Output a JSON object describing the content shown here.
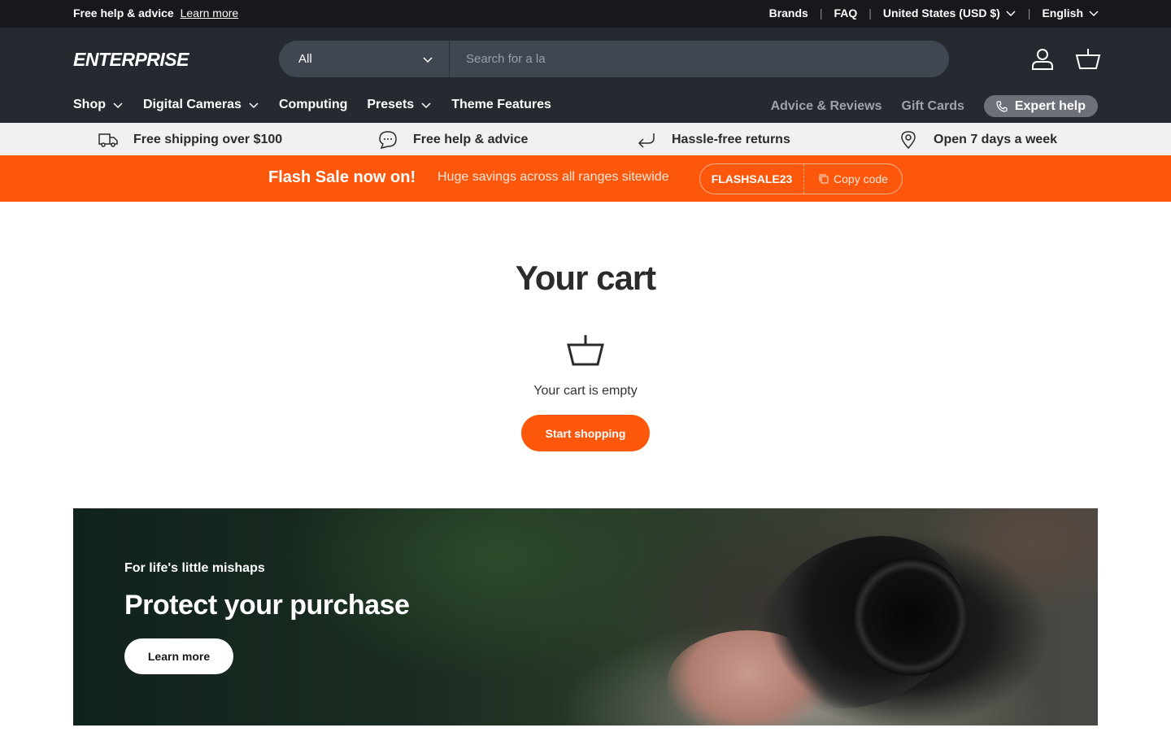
{
  "announcement": {
    "text": "Free help & advice",
    "link": "Learn more",
    "right_links": [
      "Brands",
      "FAQ"
    ],
    "currency": "United States (USD $)",
    "language": "English"
  },
  "header": {
    "logo": "ENTERPRISE",
    "search": {
      "category": "All",
      "placeholder": "Search for a la"
    }
  },
  "nav": {
    "left": [
      {
        "label": "Shop",
        "dropdown": true
      },
      {
        "label": "Digital Cameras",
        "dropdown": true
      },
      {
        "label": "Computing",
        "dropdown": false
      },
      {
        "label": "Presets",
        "dropdown": true
      },
      {
        "label": "Theme Features",
        "dropdown": false
      }
    ],
    "right": [
      "Advice & Reviews",
      "Gift Cards"
    ],
    "expert_help": "Expert help"
  },
  "usp": [
    {
      "icon": "truck-icon",
      "label": "Free shipping over $100"
    },
    {
      "icon": "chat-icon",
      "label": "Free help & advice"
    },
    {
      "icon": "return-arrow-icon",
      "label": "Hassle-free returns"
    },
    {
      "icon": "location-pin-icon",
      "label": "Open 7 days a week"
    }
  ],
  "flash_sale": {
    "title": "Flash Sale now on!",
    "subtitle": "Huge savings across all ranges sitewide",
    "code": "FLASHSALE23",
    "copy_label": "Copy code"
  },
  "cart": {
    "title": "Your cart",
    "empty_text": "Your cart is empty",
    "cta": "Start shopping"
  },
  "banner": {
    "kicker": "For life's little mishaps",
    "title": "Protect your purchase",
    "cta": "Learn more"
  },
  "colors": {
    "accent": "#fd570b",
    "header_bg": "#252a31",
    "announce_bg": "#16181b",
    "usp_bg": "#f1f1f1"
  }
}
